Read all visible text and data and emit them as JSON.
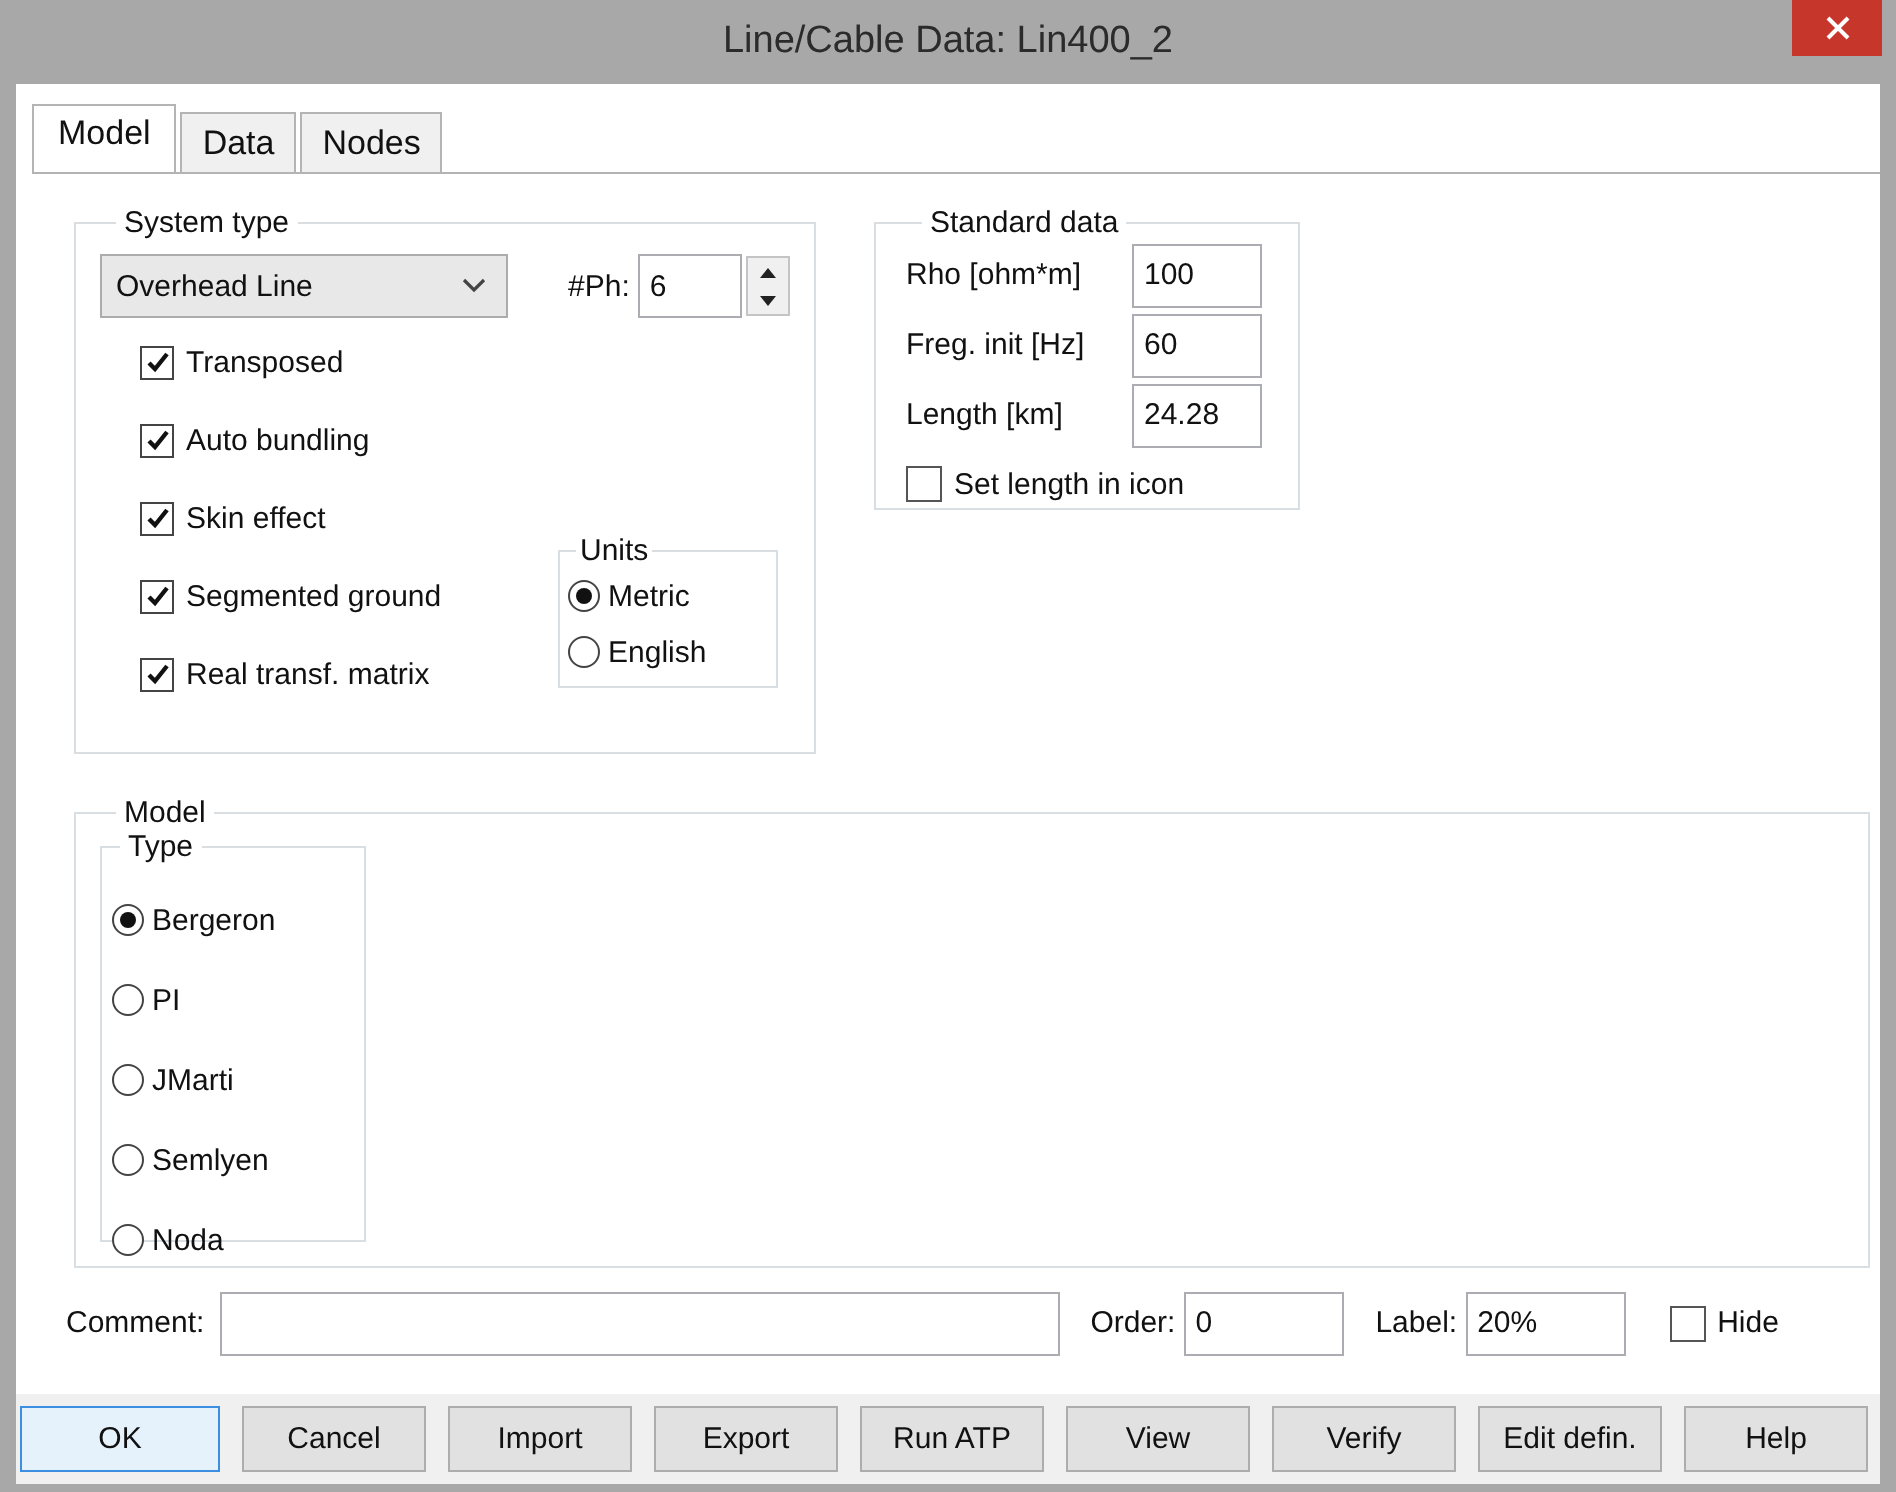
{
  "window": {
    "title": "Line/Cable Data: Lin400_2"
  },
  "tabs": [
    {
      "label": "Model",
      "selected": true
    },
    {
      "label": "Data",
      "selected": false
    },
    {
      "label": "Nodes",
      "selected": false
    }
  ],
  "system_type": {
    "legend": "System type",
    "type_value": "Overhead Line",
    "phases_label": "#Ph:",
    "phases_value": "6",
    "options": [
      {
        "label": "Transposed",
        "checked": true
      },
      {
        "label": "Auto bundling",
        "checked": true
      },
      {
        "label": "Skin effect",
        "checked": true
      },
      {
        "label": "Segmented ground",
        "checked": true
      },
      {
        "label": "Real transf. matrix",
        "checked": true
      }
    ],
    "units": {
      "legend": "Units",
      "options": [
        {
          "label": "Metric",
          "selected": true
        },
        {
          "label": "English",
          "selected": false
        }
      ]
    }
  },
  "standard_data": {
    "legend": "Standard data",
    "fields": [
      {
        "label": "Rho [ohm*m]",
        "value": "100"
      },
      {
        "label": "Freg. init [Hz]",
        "value": "60"
      },
      {
        "label": "Length [km]",
        "value": "24.28"
      }
    ],
    "set_length": {
      "label": "Set length in icon",
      "checked": false
    }
  },
  "model": {
    "legend": "Model",
    "type": {
      "legend": "Type",
      "options": [
        {
          "label": "Bergeron",
          "selected": true
        },
        {
          "label": "PI",
          "selected": false
        },
        {
          "label": "JMarti",
          "selected": false
        },
        {
          "label": "Semlyen",
          "selected": false
        },
        {
          "label": "Noda",
          "selected": false
        }
      ]
    }
  },
  "comment": {
    "label": "Comment:"
  },
  "order": {
    "label": "Order:",
    "value": "0"
  },
  "label_field": {
    "label": "Label:",
    "value": "20%"
  },
  "hide": {
    "label": "Hide",
    "checked": false
  },
  "buttons": [
    {
      "label": "OK",
      "focused": true
    },
    {
      "label": "Cancel",
      "focused": false
    },
    {
      "label": "Import",
      "focused": false
    },
    {
      "label": "Export",
      "focused": false
    },
    {
      "label": "Run ATP",
      "focused": false
    },
    {
      "label": "View",
      "focused": false
    },
    {
      "label": "Verify",
      "focused": false
    },
    {
      "label": "Edit defin.",
      "focused": false
    },
    {
      "label": "Help",
      "focused": false
    }
  ]
}
